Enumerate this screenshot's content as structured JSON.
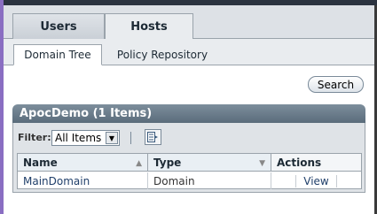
{
  "tabs": [
    {
      "label": "Users",
      "selected": false
    },
    {
      "label": "Hosts",
      "selected": true
    }
  ],
  "subtabs": [
    {
      "label": "Domain Tree",
      "selected": true
    },
    {
      "label": "Policy Repository",
      "selected": false
    }
  ],
  "search_label": "Search",
  "panel": {
    "title": "ApocDemo (1 Items)",
    "filter_label": "Filter:",
    "filter_value": "All Items",
    "columns": [
      "Name",
      "Type",
      "Actions"
    ],
    "rows": [
      {
        "name": "MainDomain",
        "type": "Domain",
        "action": "View"
      }
    ]
  },
  "icons": {
    "filter_arrow": "chevron-down-icon",
    "sort_name": "sort-ascending-icon",
    "sort_type": "sort-descending-icon",
    "tool": "table-preferences-icon"
  }
}
